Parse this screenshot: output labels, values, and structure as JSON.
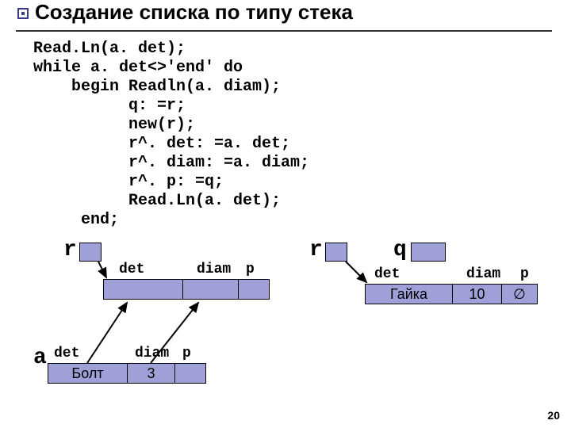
{
  "title": "Создание списка по типу стека",
  "code": "Read.Ln(a. det);\nwhile a. det<>'end' do\n    begin Readln(a. diam);\n          q: =r;\n          new(r);\n          r^. det: =a. det;\n          r^. diam: =a. diam;\n          r^. p: =q;\n          Read.Ln(a. det);\n     end;",
  "left": {
    "r": "r",
    "fields": {
      "det": "det",
      "diam": "diam",
      "p": "p"
    },
    "a": "a",
    "afields": {
      "det": "det",
      "diam": "diam",
      "p": "p"
    },
    "avalues": {
      "det": "Болт",
      "diam": "3"
    }
  },
  "right": {
    "r": "r",
    "q": "q",
    "fields": {
      "det": "det",
      "diam": "diam",
      "p": "p"
    },
    "values": {
      "det": "Гайка",
      "diam": "10",
      "p": "∅"
    }
  },
  "page": "20"
}
